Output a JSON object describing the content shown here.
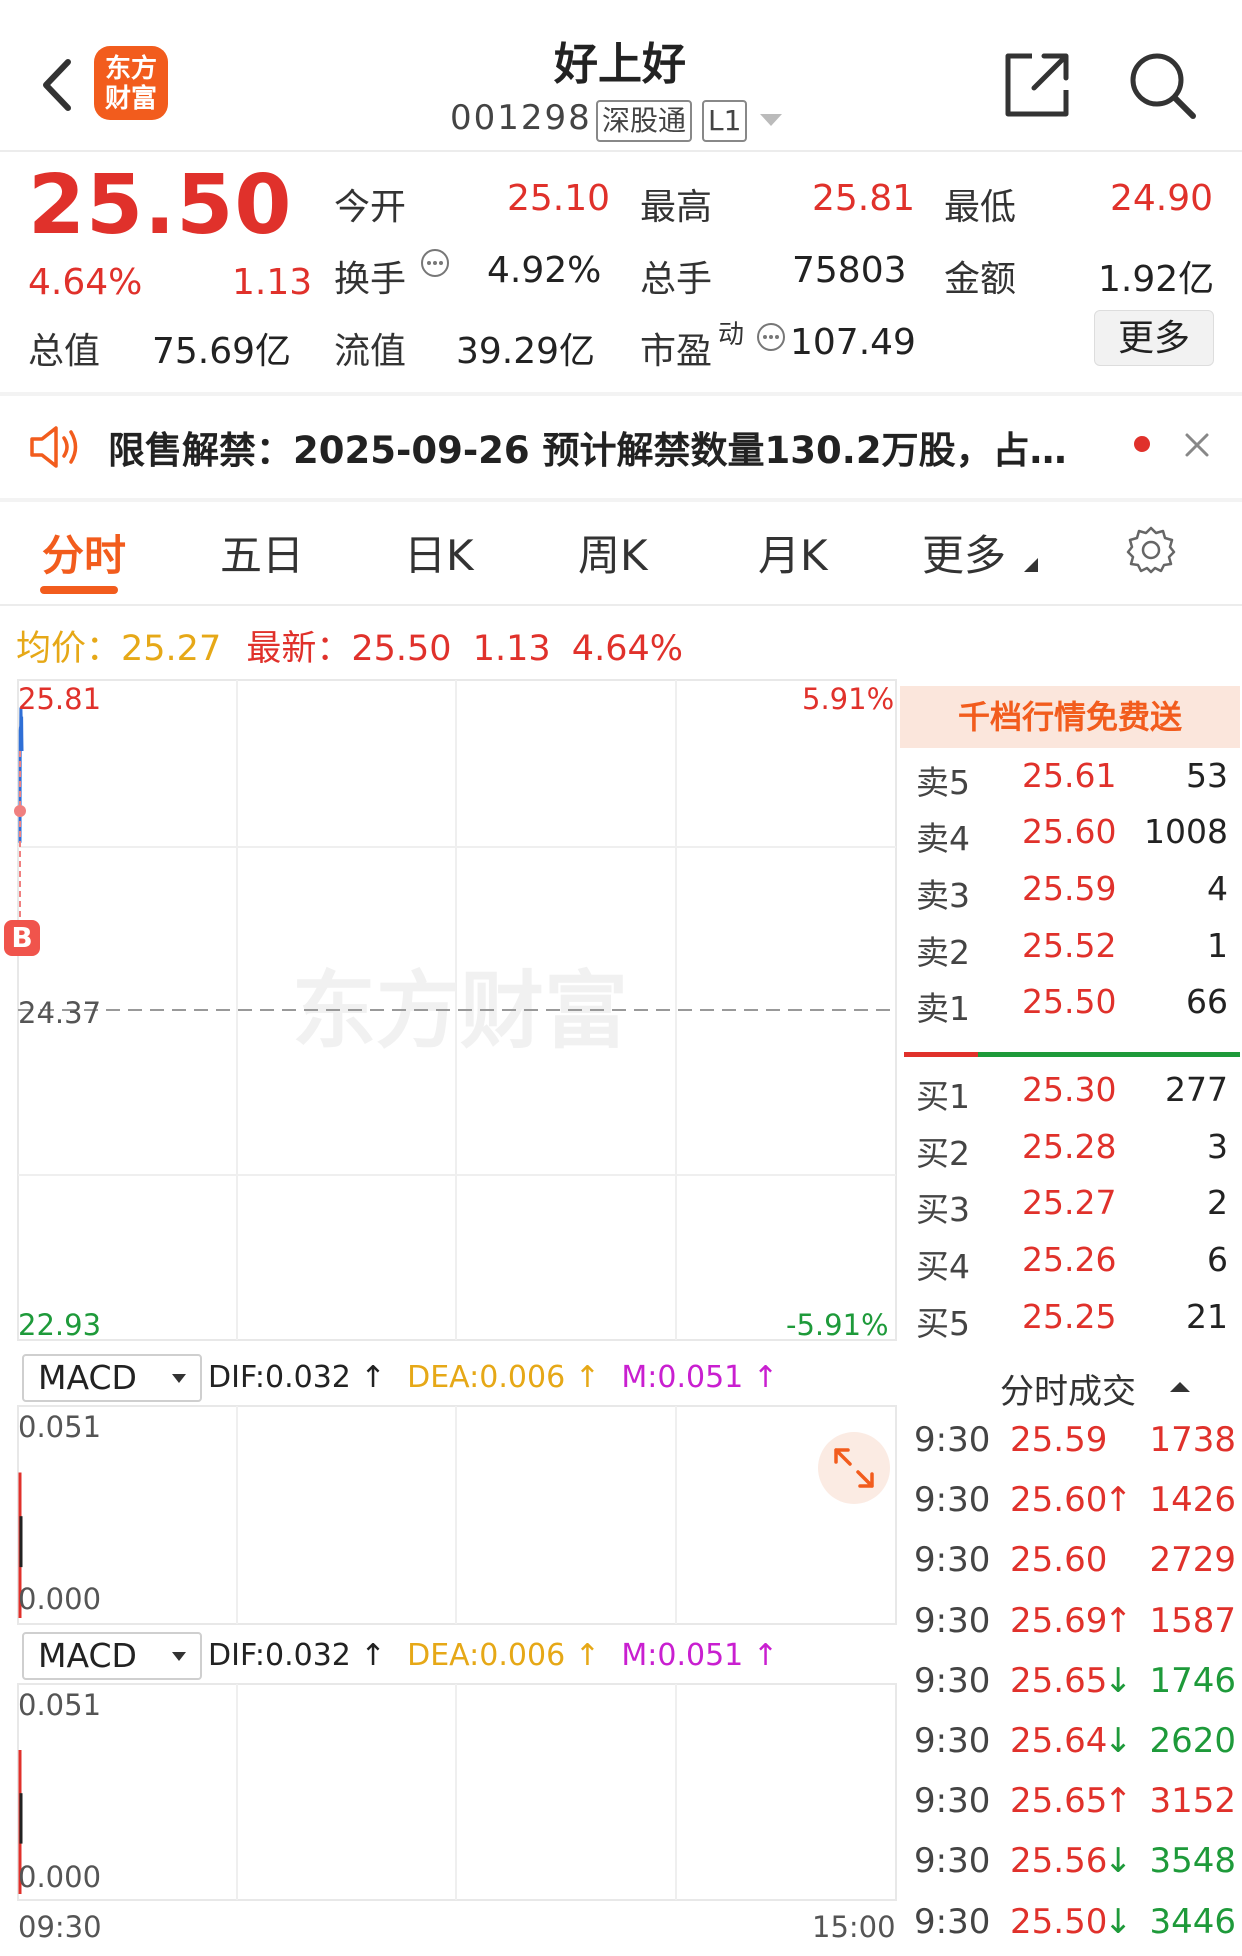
{
  "header": {
    "logo_line1": "东方",
    "logo_line2": "财富",
    "stock_name": "好上好",
    "stock_code": "001298",
    "tag_exchange": "深股通",
    "tag_level": "L1"
  },
  "quote": {
    "price": "25.50",
    "change_pct": "4.64%",
    "change_amt": "1.13",
    "open_label": "今开",
    "open": "25.10",
    "high_label": "最高",
    "high": "25.81",
    "low_label": "最低",
    "low": "24.90",
    "turnover_label": "换手",
    "turnover": "4.92%",
    "volume_label": "总手",
    "volume": "75803",
    "amount_label": "金额",
    "amount": "1.92亿",
    "mcap_label": "总值",
    "mcap": "75.69亿",
    "float_label": "流值",
    "float_cap": "39.29亿",
    "pe_label": "市盈",
    "pe_sup": "动",
    "pe": "107.49",
    "more_label": "更多"
  },
  "notice": {
    "text": "限售解禁：2025-09-26 预计解禁数量130.2万股，占…"
  },
  "tabs": [
    {
      "label": "分时"
    },
    {
      "label": "五日"
    },
    {
      "label": "日K"
    },
    {
      "label": "周K"
    },
    {
      "label": "月K"
    },
    {
      "label": "更多"
    }
  ],
  "summary": {
    "avg_label": "均价：",
    "avg": "25.27",
    "latest_label": "最新：",
    "latest": "25.50",
    "change_amt": "1.13",
    "change_pct": "4.64%"
  },
  "chart_data": {
    "type": "line",
    "y_max_label": "25.81",
    "y_mid_label": "24.37",
    "y_min_label": "22.93",
    "pct_max_label": "5.91%",
    "pct_min_label": "-5.91%",
    "ylim": [
      22.93,
      25.81
    ],
    "prev_close": 24.37,
    "x_start_label": "09:30",
    "x_end_label": "15:00",
    "series": [
      {
        "values": [
          25.1,
          25.59,
          25.6,
          25.6,
          25.69,
          25.65,
          25.64,
          25.65,
          25.56,
          25.5
        ]
      }
    ],
    "buy_marker": "B",
    "watermark": "东方财富",
    "indicators": [
      {
        "name": "MACD",
        "dif": "DIF:0.032",
        "dea": "DEA:0.006",
        "m": "M:0.051",
        "top_label": "0.051",
        "bottom_label": "0.000",
        "bar_value": 0.051
      },
      {
        "name": "MACD",
        "dif": "DIF:0.032",
        "dea": "DEA:0.006",
        "m": "M:0.051",
        "top_label": "0.051",
        "bottom_label": "0.000",
        "bar_value": 0.051
      }
    ]
  },
  "orderbook": {
    "header": "千档行情免费送",
    "asks": [
      {
        "label": "卖5",
        "price": "25.61",
        "qty": "53"
      },
      {
        "label": "卖4",
        "price": "25.60",
        "qty": "1008"
      },
      {
        "label": "卖3",
        "price": "25.59",
        "qty": "4"
      },
      {
        "label": "卖2",
        "price": "25.52",
        "qty": "1"
      },
      {
        "label": "卖1",
        "price": "25.50",
        "qty": "66"
      }
    ],
    "bids": [
      {
        "label": "买1",
        "price": "25.30",
        "qty": "277"
      },
      {
        "label": "买2",
        "price": "25.28",
        "qty": "3"
      },
      {
        "label": "买3",
        "price": "25.27",
        "qty": "2"
      },
      {
        "label": "买4",
        "price": "25.26",
        "qty": "6"
      },
      {
        "label": "买5",
        "price": "25.25",
        "qty": "21"
      }
    ]
  },
  "ticks": {
    "title": "分时成交",
    "rows": [
      {
        "time": "9:30",
        "price": "25.59",
        "arrow": "",
        "qty": "1738",
        "dir": "buy"
      },
      {
        "time": "9:30",
        "price": "25.60",
        "arrow": "↑",
        "qty": "1426",
        "dir": "buy"
      },
      {
        "time": "9:30",
        "price": "25.60",
        "arrow": "",
        "qty": "2729",
        "dir": "buy"
      },
      {
        "time": "9:30",
        "price": "25.69",
        "arrow": "↑",
        "qty": "1587",
        "dir": "buy"
      },
      {
        "time": "9:30",
        "price": "25.65",
        "arrow": "↓",
        "qty": "1746",
        "dir": "sell"
      },
      {
        "time": "9:30",
        "price": "25.64",
        "arrow": "↓",
        "qty": "2620",
        "dir": "sell"
      },
      {
        "time": "9:30",
        "price": "25.65",
        "arrow": "↑",
        "qty": "3152",
        "dir": "buy"
      },
      {
        "time": "9:30",
        "price": "25.56",
        "arrow": "↓",
        "qty": "3548",
        "dir": "sell"
      },
      {
        "time": "9:30",
        "price": "25.50",
        "arrow": "↓",
        "qty": "3446",
        "dir": "sell"
      }
    ]
  },
  "colors": {
    "up": "#e0312b",
    "down": "#1e9a3a",
    "accent": "#f25c1d",
    "avg": "#e6a817",
    "m_line": "#c91fd0"
  }
}
